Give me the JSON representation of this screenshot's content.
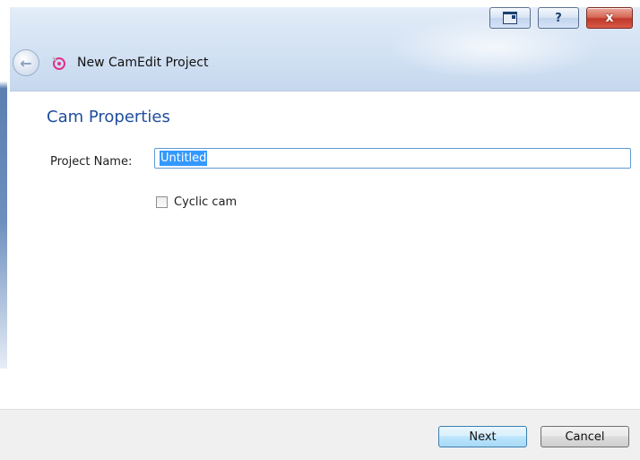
{
  "window": {
    "title": "New CamEdit Project",
    "controls": {
      "help_label": "?",
      "close_label": "x"
    }
  },
  "page": {
    "heading": "Cam Properties"
  },
  "form": {
    "project_name_label": "Project Name:",
    "project_name_value": "Untitled",
    "cyclic_label": "Cyclic cam",
    "cyclic_checked": false
  },
  "footer": {
    "next_label": "Next",
    "cancel_label": "Cancel"
  },
  "icons": {
    "back": "back-arrow-icon",
    "app": "camedit-app-icon",
    "restore": "restore-icon",
    "help": "help-icon",
    "close": "close-icon"
  },
  "colors": {
    "heading": "#1f4e9b",
    "selection": "#3399ff",
    "input_border": "#5f9ad6",
    "footer_bg": "#f0f0f0"
  }
}
